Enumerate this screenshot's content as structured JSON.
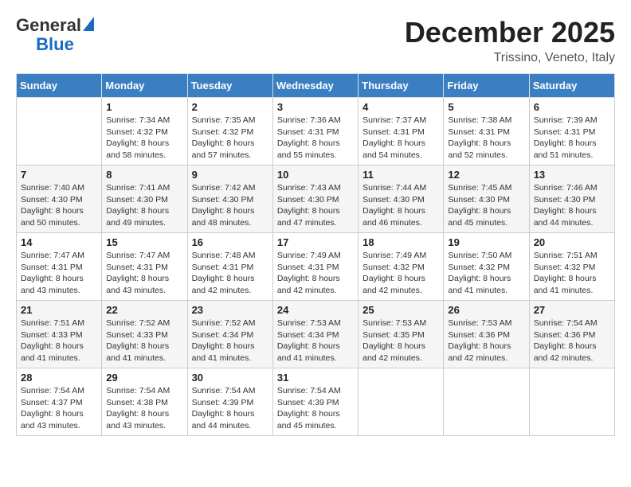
{
  "logo": {
    "general": "General",
    "blue": "Blue"
  },
  "header": {
    "month": "December 2025",
    "location": "Trissino, Veneto, Italy"
  },
  "weekdays": [
    "Sunday",
    "Monday",
    "Tuesday",
    "Wednesday",
    "Thursday",
    "Friday",
    "Saturday"
  ],
  "weeks": [
    [
      {
        "day": "",
        "sunrise": "",
        "sunset": "",
        "daylight": ""
      },
      {
        "day": "1",
        "sunrise": "Sunrise: 7:34 AM",
        "sunset": "Sunset: 4:32 PM",
        "daylight": "Daylight: 8 hours and 58 minutes."
      },
      {
        "day": "2",
        "sunrise": "Sunrise: 7:35 AM",
        "sunset": "Sunset: 4:32 PM",
        "daylight": "Daylight: 8 hours and 57 minutes."
      },
      {
        "day": "3",
        "sunrise": "Sunrise: 7:36 AM",
        "sunset": "Sunset: 4:31 PM",
        "daylight": "Daylight: 8 hours and 55 minutes."
      },
      {
        "day": "4",
        "sunrise": "Sunrise: 7:37 AM",
        "sunset": "Sunset: 4:31 PM",
        "daylight": "Daylight: 8 hours and 54 minutes."
      },
      {
        "day": "5",
        "sunrise": "Sunrise: 7:38 AM",
        "sunset": "Sunset: 4:31 PM",
        "daylight": "Daylight: 8 hours and 52 minutes."
      },
      {
        "day": "6",
        "sunrise": "Sunrise: 7:39 AM",
        "sunset": "Sunset: 4:31 PM",
        "daylight": "Daylight: 8 hours and 51 minutes."
      }
    ],
    [
      {
        "day": "7",
        "sunrise": "Sunrise: 7:40 AM",
        "sunset": "Sunset: 4:30 PM",
        "daylight": "Daylight: 8 hours and 50 minutes."
      },
      {
        "day": "8",
        "sunrise": "Sunrise: 7:41 AM",
        "sunset": "Sunset: 4:30 PM",
        "daylight": "Daylight: 8 hours and 49 minutes."
      },
      {
        "day": "9",
        "sunrise": "Sunrise: 7:42 AM",
        "sunset": "Sunset: 4:30 PM",
        "daylight": "Daylight: 8 hours and 48 minutes."
      },
      {
        "day": "10",
        "sunrise": "Sunrise: 7:43 AM",
        "sunset": "Sunset: 4:30 PM",
        "daylight": "Daylight: 8 hours and 47 minutes."
      },
      {
        "day": "11",
        "sunrise": "Sunrise: 7:44 AM",
        "sunset": "Sunset: 4:30 PM",
        "daylight": "Daylight: 8 hours and 46 minutes."
      },
      {
        "day": "12",
        "sunrise": "Sunrise: 7:45 AM",
        "sunset": "Sunset: 4:30 PM",
        "daylight": "Daylight: 8 hours and 45 minutes."
      },
      {
        "day": "13",
        "sunrise": "Sunrise: 7:46 AM",
        "sunset": "Sunset: 4:30 PM",
        "daylight": "Daylight: 8 hours and 44 minutes."
      }
    ],
    [
      {
        "day": "14",
        "sunrise": "Sunrise: 7:47 AM",
        "sunset": "Sunset: 4:31 PM",
        "daylight": "Daylight: 8 hours and 43 minutes."
      },
      {
        "day": "15",
        "sunrise": "Sunrise: 7:47 AM",
        "sunset": "Sunset: 4:31 PM",
        "daylight": "Daylight: 8 hours and 43 minutes."
      },
      {
        "day": "16",
        "sunrise": "Sunrise: 7:48 AM",
        "sunset": "Sunset: 4:31 PM",
        "daylight": "Daylight: 8 hours and 42 minutes."
      },
      {
        "day": "17",
        "sunrise": "Sunrise: 7:49 AM",
        "sunset": "Sunset: 4:31 PM",
        "daylight": "Daylight: 8 hours and 42 minutes."
      },
      {
        "day": "18",
        "sunrise": "Sunrise: 7:49 AM",
        "sunset": "Sunset: 4:32 PM",
        "daylight": "Daylight: 8 hours and 42 minutes."
      },
      {
        "day": "19",
        "sunrise": "Sunrise: 7:50 AM",
        "sunset": "Sunset: 4:32 PM",
        "daylight": "Daylight: 8 hours and 41 minutes."
      },
      {
        "day": "20",
        "sunrise": "Sunrise: 7:51 AM",
        "sunset": "Sunset: 4:32 PM",
        "daylight": "Daylight: 8 hours and 41 minutes."
      }
    ],
    [
      {
        "day": "21",
        "sunrise": "Sunrise: 7:51 AM",
        "sunset": "Sunset: 4:33 PM",
        "daylight": "Daylight: 8 hours and 41 minutes."
      },
      {
        "day": "22",
        "sunrise": "Sunrise: 7:52 AM",
        "sunset": "Sunset: 4:33 PM",
        "daylight": "Daylight: 8 hours and 41 minutes."
      },
      {
        "day": "23",
        "sunrise": "Sunrise: 7:52 AM",
        "sunset": "Sunset: 4:34 PM",
        "daylight": "Daylight: 8 hours and 41 minutes."
      },
      {
        "day": "24",
        "sunrise": "Sunrise: 7:53 AM",
        "sunset": "Sunset: 4:34 PM",
        "daylight": "Daylight: 8 hours and 41 minutes."
      },
      {
        "day": "25",
        "sunrise": "Sunrise: 7:53 AM",
        "sunset": "Sunset: 4:35 PM",
        "daylight": "Daylight: 8 hours and 42 minutes."
      },
      {
        "day": "26",
        "sunrise": "Sunrise: 7:53 AM",
        "sunset": "Sunset: 4:36 PM",
        "daylight": "Daylight: 8 hours and 42 minutes."
      },
      {
        "day": "27",
        "sunrise": "Sunrise: 7:54 AM",
        "sunset": "Sunset: 4:36 PM",
        "daylight": "Daylight: 8 hours and 42 minutes."
      }
    ],
    [
      {
        "day": "28",
        "sunrise": "Sunrise: 7:54 AM",
        "sunset": "Sunset: 4:37 PM",
        "daylight": "Daylight: 8 hours and 43 minutes."
      },
      {
        "day": "29",
        "sunrise": "Sunrise: 7:54 AM",
        "sunset": "Sunset: 4:38 PM",
        "daylight": "Daylight: 8 hours and 43 minutes."
      },
      {
        "day": "30",
        "sunrise": "Sunrise: 7:54 AM",
        "sunset": "Sunset: 4:39 PM",
        "daylight": "Daylight: 8 hours and 44 minutes."
      },
      {
        "day": "31",
        "sunrise": "Sunrise: 7:54 AM",
        "sunset": "Sunset: 4:39 PM",
        "daylight": "Daylight: 8 hours and 45 minutes."
      },
      {
        "day": "",
        "sunrise": "",
        "sunset": "",
        "daylight": ""
      },
      {
        "day": "",
        "sunrise": "",
        "sunset": "",
        "daylight": ""
      },
      {
        "day": "",
        "sunrise": "",
        "sunset": "",
        "daylight": ""
      }
    ]
  ]
}
